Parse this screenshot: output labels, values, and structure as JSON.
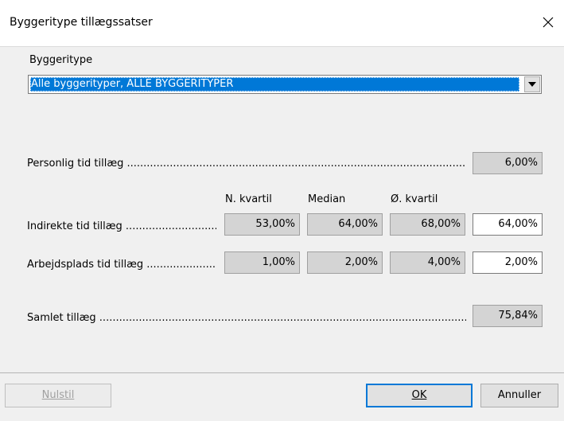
{
  "window": {
    "title": "Byggeritype tillægssatser"
  },
  "byggeritype": {
    "label": "Byggeritype",
    "selected": "Alle byggerityper, ALLE BYGGERITYPER"
  },
  "columns": {
    "n_kvartil": "N. kvartil",
    "median": "Median",
    "o_kvartil": "Ø. kvartil"
  },
  "rows": {
    "personlig": {
      "label": "Personlig tid tillæg ............................................................................................................................................................",
      "value": "6,00%"
    },
    "indirekte": {
      "label": "Indirekte tid tillæg .........................................................",
      "n_kvartil": "53,00%",
      "median": "64,00%",
      "o_kvartil": "68,00%",
      "value": "64,00%"
    },
    "arbejdsplads": {
      "label": "Arbejdsplads tid tillæg ....................................................",
      "n_kvartil": "1,00%",
      "median": "2,00%",
      "o_kvartil": "4,00%",
      "value": "2,00%"
    },
    "samlet": {
      "label": "Samlet tillæg .......................................................................................................................................................................",
      "value": "75,84%"
    }
  },
  "buttons": {
    "nulstil": "Nulstil",
    "ok": "OK",
    "annuller": "Annuller"
  }
}
